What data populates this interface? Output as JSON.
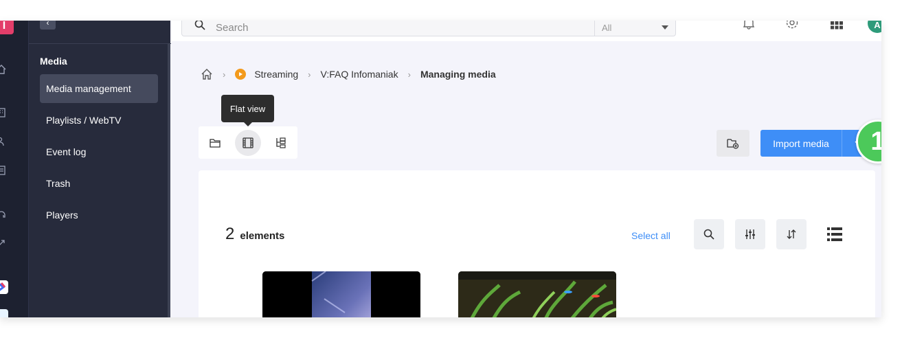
{
  "app": {
    "logo_letter": "I",
    "avatar_initial": "A"
  },
  "topbar": {
    "search_placeholder": "Search",
    "search_scope": "All"
  },
  "sidebar": {
    "section_title": "Media",
    "items": [
      {
        "label": "Media management",
        "active": true
      },
      {
        "label": "Playlists / WebTV",
        "active": false
      },
      {
        "label": "Event log",
        "active": false
      },
      {
        "label": "Trash",
        "active": false
      },
      {
        "label": "Players",
        "active": false
      }
    ]
  },
  "breadcrumb": {
    "items": [
      "Streaming",
      "V:FAQ Infomaniak",
      "Managing media"
    ]
  },
  "tooltip": {
    "text": "Flat view"
  },
  "actions": {
    "import_label": "Import media"
  },
  "annotation": {
    "step": "1"
  },
  "panel": {
    "count": "2",
    "count_label": "elements",
    "select_all": "Select all"
  },
  "colors": {
    "accent": "#3e8ef7",
    "step_badge": "#4cc95a",
    "sidebar_bg": "#272b3c",
    "rail_bg": "#1d2130"
  }
}
